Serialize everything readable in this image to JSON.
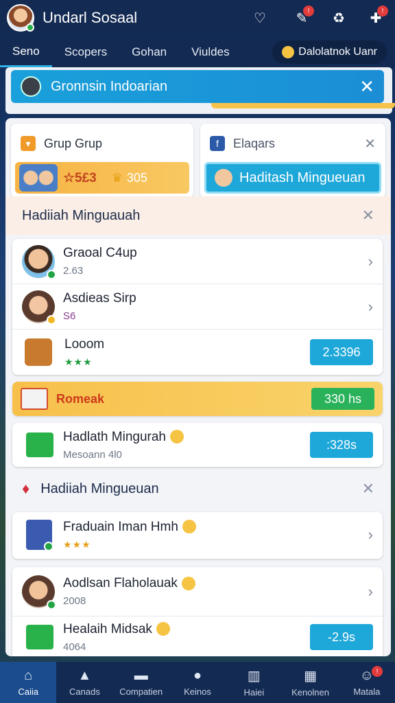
{
  "header": {
    "app_title": "Undarl Sosaal",
    "icons": [
      "heart-icon",
      "feather-icon",
      "recycle-icon",
      "puzzle-icon"
    ],
    "badges": [
      "!",
      "!"
    ]
  },
  "tabs": [
    {
      "label": "Seno",
      "active": true
    },
    {
      "label": "Scopers",
      "active": false
    },
    {
      "label": "Gohan",
      "active": false
    },
    {
      "label": "Viuldes",
      "active": false
    }
  ],
  "tab_chip": {
    "label": "Dalolatnok Uanr"
  },
  "banner": {
    "title": "Gronnsin Indoarian",
    "close": "✕"
  },
  "card_left": {
    "title": "Grup Grup",
    "strip_value_1": "☆5£3",
    "strip_value_2": "305"
  },
  "card_right": {
    "title": "Elaqars",
    "close": "✕",
    "button_label": "Haditash Mingueuan"
  },
  "section1": {
    "title": "Hadiiah Minguauah",
    "close": "✕"
  },
  "list1": [
    {
      "title": "Graoal C4up",
      "sub": "2.63",
      "chevron": "›"
    },
    {
      "title": "Asdieas Sirp",
      "sub": "S6",
      "chevron": "›"
    },
    {
      "title": "Looom",
      "stars": "★★★",
      "pill": "2.3396"
    }
  ],
  "promo": {
    "title": "Romeak",
    "pill": "330 hs"
  },
  "task_row": {
    "title": "Hadlath Mingurah",
    "sub": "Mesoann 4l0",
    "pill": ":328s"
  },
  "section2": {
    "title": "Hadiiah Mingueuan",
    "close": "✕"
  },
  "list2": [
    {
      "title": "Fraduain Iman Hmh",
      "stars": "★★★",
      "chevron": "›"
    }
  ],
  "list3": [
    {
      "title": "Aodlsan Flaholauak",
      "sub": "2008",
      "chevron": "›"
    },
    {
      "title": "Healaih Midsak",
      "sub": "4064",
      "pill": "-2.9s"
    }
  ],
  "bottom_nav": [
    {
      "label": "Caiia",
      "icon": "home-icon",
      "active": true
    },
    {
      "label": "Canads",
      "icon": "house-icon",
      "active": false
    },
    {
      "label": "Compatien",
      "icon": "card-icon",
      "active": false
    },
    {
      "label": "Keinos",
      "icon": "ball-icon",
      "active": false
    },
    {
      "label": "Haiei",
      "icon": "bars-icon",
      "active": false
    },
    {
      "label": "Kenolnen",
      "icon": "grid-icon",
      "active": false
    },
    {
      "label": "Matala",
      "icon": "profile-icon",
      "active": false,
      "badge": "!"
    }
  ]
}
